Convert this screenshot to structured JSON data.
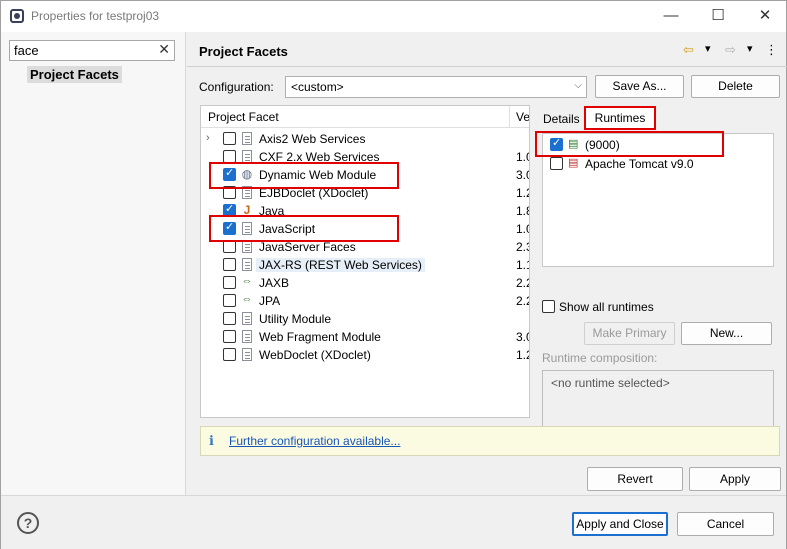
{
  "window": {
    "title": "Properties for testproj03",
    "minimize_glyph": "—",
    "maximize_glyph": "☐",
    "close_glyph": "✕"
  },
  "left": {
    "filter_value": "face",
    "filter_clear_glyph": "✕",
    "selected_item": "Project Facets"
  },
  "page": {
    "title": "Project Facets",
    "nav_back": "⇦",
    "nav_fwd": "⇨",
    "nav_menu": "▾",
    "more": "⋮"
  },
  "config": {
    "label": "Configuration:",
    "value": "<custom>",
    "arrow": "⌵",
    "save_as": "Save As...",
    "delete": "Delete"
  },
  "facets": {
    "col_facet": "Project Facet",
    "col_version": "Ve",
    "rows": [
      {
        "label": "Axis2 Web Services",
        "version": "",
        "checked": false,
        "icon": "doc-icon",
        "expander": "›"
      },
      {
        "label": "CXF 2.x Web Services",
        "version": "1.0",
        "checked": false,
        "icon": "doc-icon"
      },
      {
        "label": "Dynamic Web Module",
        "version": "3.0",
        "checked": true,
        "icon": "globe-icon"
      },
      {
        "label": "EJBDoclet (XDoclet)",
        "version": "1.2",
        "checked": false,
        "icon": "doc-icon"
      },
      {
        "label": "Java",
        "version": "1.8",
        "checked": true,
        "icon": "java-icon"
      },
      {
        "label": "JavaScript",
        "version": "1.0",
        "checked": true,
        "icon": "doc-icon"
      },
      {
        "label": "JavaServer Faces",
        "version": "2.3",
        "checked": false,
        "icon": "doc-icon"
      },
      {
        "label": "JAX-RS (REST Web Services)",
        "version": "1.1",
        "checked": false,
        "icon": "doc-icon"
      },
      {
        "label": "JAXB",
        "version": "2.2",
        "checked": false,
        "icon": "jaxb-icon"
      },
      {
        "label": "JPA",
        "version": "2.2",
        "checked": false,
        "icon": "jpa-icon"
      },
      {
        "label": "Utility Module",
        "version": "",
        "checked": false,
        "icon": "doc-icon"
      },
      {
        "label": "Web Fragment Module",
        "version": "3.0",
        "checked": false,
        "icon": "doc-icon"
      },
      {
        "label": "WebDoclet (XDoclet)",
        "version": "1.2",
        "checked": false,
        "icon": "doc-icon"
      }
    ]
  },
  "tabs": {
    "details": "Details",
    "runtimes": "Runtimes"
  },
  "runtimes": {
    "items": [
      {
        "label": "(9000)",
        "checked": true
      },
      {
        "label": "Apache Tomcat v9.0",
        "checked": false
      }
    ],
    "show_all": "Show all runtimes",
    "make_primary": "Make Primary",
    "new": "New...",
    "composition_label": "Runtime composition:",
    "composition_value": "<no runtime selected>"
  },
  "info": {
    "icon": "ℹ",
    "link": "Further configuration available..."
  },
  "buttons": {
    "revert": "Revert",
    "apply": "Apply",
    "apply_close": "Apply and Close",
    "cancel": "Cancel",
    "help": "?"
  },
  "colors": {
    "highlight_red": "#e00000",
    "checkbox_blue": "#1a6fcf",
    "link_blue": "#1a56b5"
  }
}
